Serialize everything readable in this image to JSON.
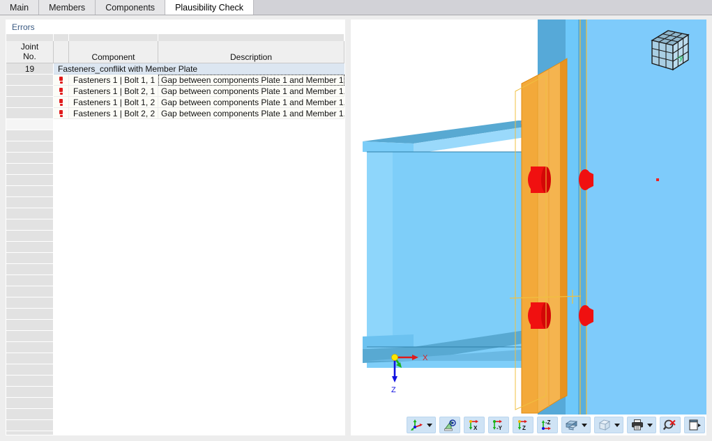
{
  "tabs": [
    {
      "label": "Main",
      "active": false
    },
    {
      "label": "Members",
      "active": false
    },
    {
      "label": "Components",
      "active": false
    },
    {
      "label": "Plausibility Check",
      "active": true
    }
  ],
  "panel": {
    "caption": "Errors"
  },
  "table": {
    "headers": {
      "joint_no": "Joint\nNo.",
      "joint_no_line1": "Joint",
      "joint_no_line2": "No.",
      "icon": "",
      "component": "Component",
      "description": "Description"
    },
    "groups": [
      {
        "joint_no": "19",
        "title": "Fasteners_conflikt with Member Plate",
        "rows": [
          {
            "icon": "error-icon",
            "component": "Fasteners 1 | Bolt 1, 1",
            "description": "Gap between components Plate 1 and Member 1, ...",
            "focused": true
          },
          {
            "icon": "error-icon",
            "component": "Fasteners 1 | Bolt 2, 1",
            "description": "Gap between components Plate 1 and Member 1, ...",
            "focused": false
          },
          {
            "icon": "error-icon",
            "component": "Fasteners 1 | Bolt 1, 2",
            "description": "Gap between components Plate 1 and Member 1, ...",
            "focused": false
          },
          {
            "icon": "error-icon",
            "component": "Fasteners 1 | Bolt 2, 2",
            "description": "Gap between components Plate 1 and Member 1, ...",
            "focused": false
          }
        ]
      }
    ]
  },
  "viewport": {
    "nav_cube_label": "-y",
    "axes": {
      "x_label": "X",
      "y_label": "Y",
      "z_label": "Z",
      "x_color": "#e01b1b",
      "y_color": "#19b219",
      "z_color": "#1010e0",
      "origin_color": "#ffe600"
    },
    "colors": {
      "background": "#7ecbfb",
      "member_blue": "#6ec8fa",
      "member_blue_dark": "#4fa3d1",
      "plate_orange": "#f0a030",
      "plate_orange_light": "#f7b85c",
      "bolt_red": "#f01010",
      "gap_pink": "#f5a0a8",
      "guide_yellow": "#f0c040",
      "marker_red": "#f02020"
    }
  },
  "toolbar": {
    "buttons": [
      {
        "name": "view-axes-button",
        "icon": "axes-icon",
        "has_caret": true,
        "title": "Set View Direction"
      },
      {
        "name": "perspective-button",
        "icon": "perspective-eye-icon",
        "has_caret": false,
        "title": "Perspective View"
      },
      {
        "name": "view-x-button",
        "icon": "axis-x-icon",
        "has_caret": false,
        "label": "X",
        "title": "View in X"
      },
      {
        "name": "view-neg-y-button",
        "icon": "axis-negy-icon",
        "has_caret": false,
        "label": "-Y",
        "title": "View in -Y"
      },
      {
        "name": "view-z-button",
        "icon": "axis-z-icon",
        "has_caret": false,
        "label": "Z",
        "title": "View in Z"
      },
      {
        "name": "view-neg-z-button",
        "icon": "axis-negz-icon",
        "has_caret": false,
        "label": "-Z",
        "title": "View in -Z"
      },
      {
        "name": "render-mode-button",
        "icon": "solid-blocks-icon",
        "has_caret": true,
        "title": "Rendering"
      },
      {
        "name": "wireframe-button",
        "icon": "wireframe-cube-icon",
        "has_caret": true,
        "title": "Wireframe"
      },
      {
        "name": "print-button",
        "icon": "printer-icon",
        "has_caret": true,
        "title": "Print"
      },
      {
        "name": "zoom-reset-button",
        "icon": "zoom-cancel-icon",
        "has_caret": false,
        "title": "Reset Zoom"
      },
      {
        "name": "panel-toggle-button",
        "icon": "panel-expand-icon",
        "has_caret": false,
        "title": "Show/Hide Panel"
      }
    ]
  }
}
